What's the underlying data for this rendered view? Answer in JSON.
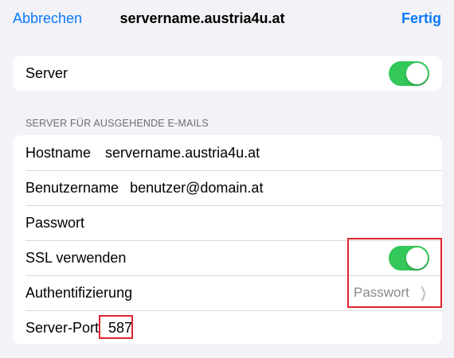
{
  "nav": {
    "cancel_label": "Abbrechen",
    "title": "servername.austria4u.at",
    "done_label": "Fertig"
  },
  "server": {
    "label": "Server",
    "enabled": true
  },
  "outgoing": {
    "section_header": "SERVER FÜR AUSGEHENDE E-MAILS",
    "hostname_label": "Hostname",
    "hostname_value": "servername.austria4u.at",
    "username_label": "Benutzername",
    "username_value": "benutzer@domain.at",
    "password_label": "Passwort",
    "ssl_label": "SSL verwenden",
    "ssl_enabled": true,
    "auth_label": "Authentifizierung",
    "auth_value": "Passwort",
    "port_label": "Server-Port",
    "port_value": "587"
  },
  "colors": {
    "accent": "#0a7aff",
    "toggle_on": "#34c759",
    "highlight": "#e0242f",
    "background": "#f2f2f7"
  }
}
